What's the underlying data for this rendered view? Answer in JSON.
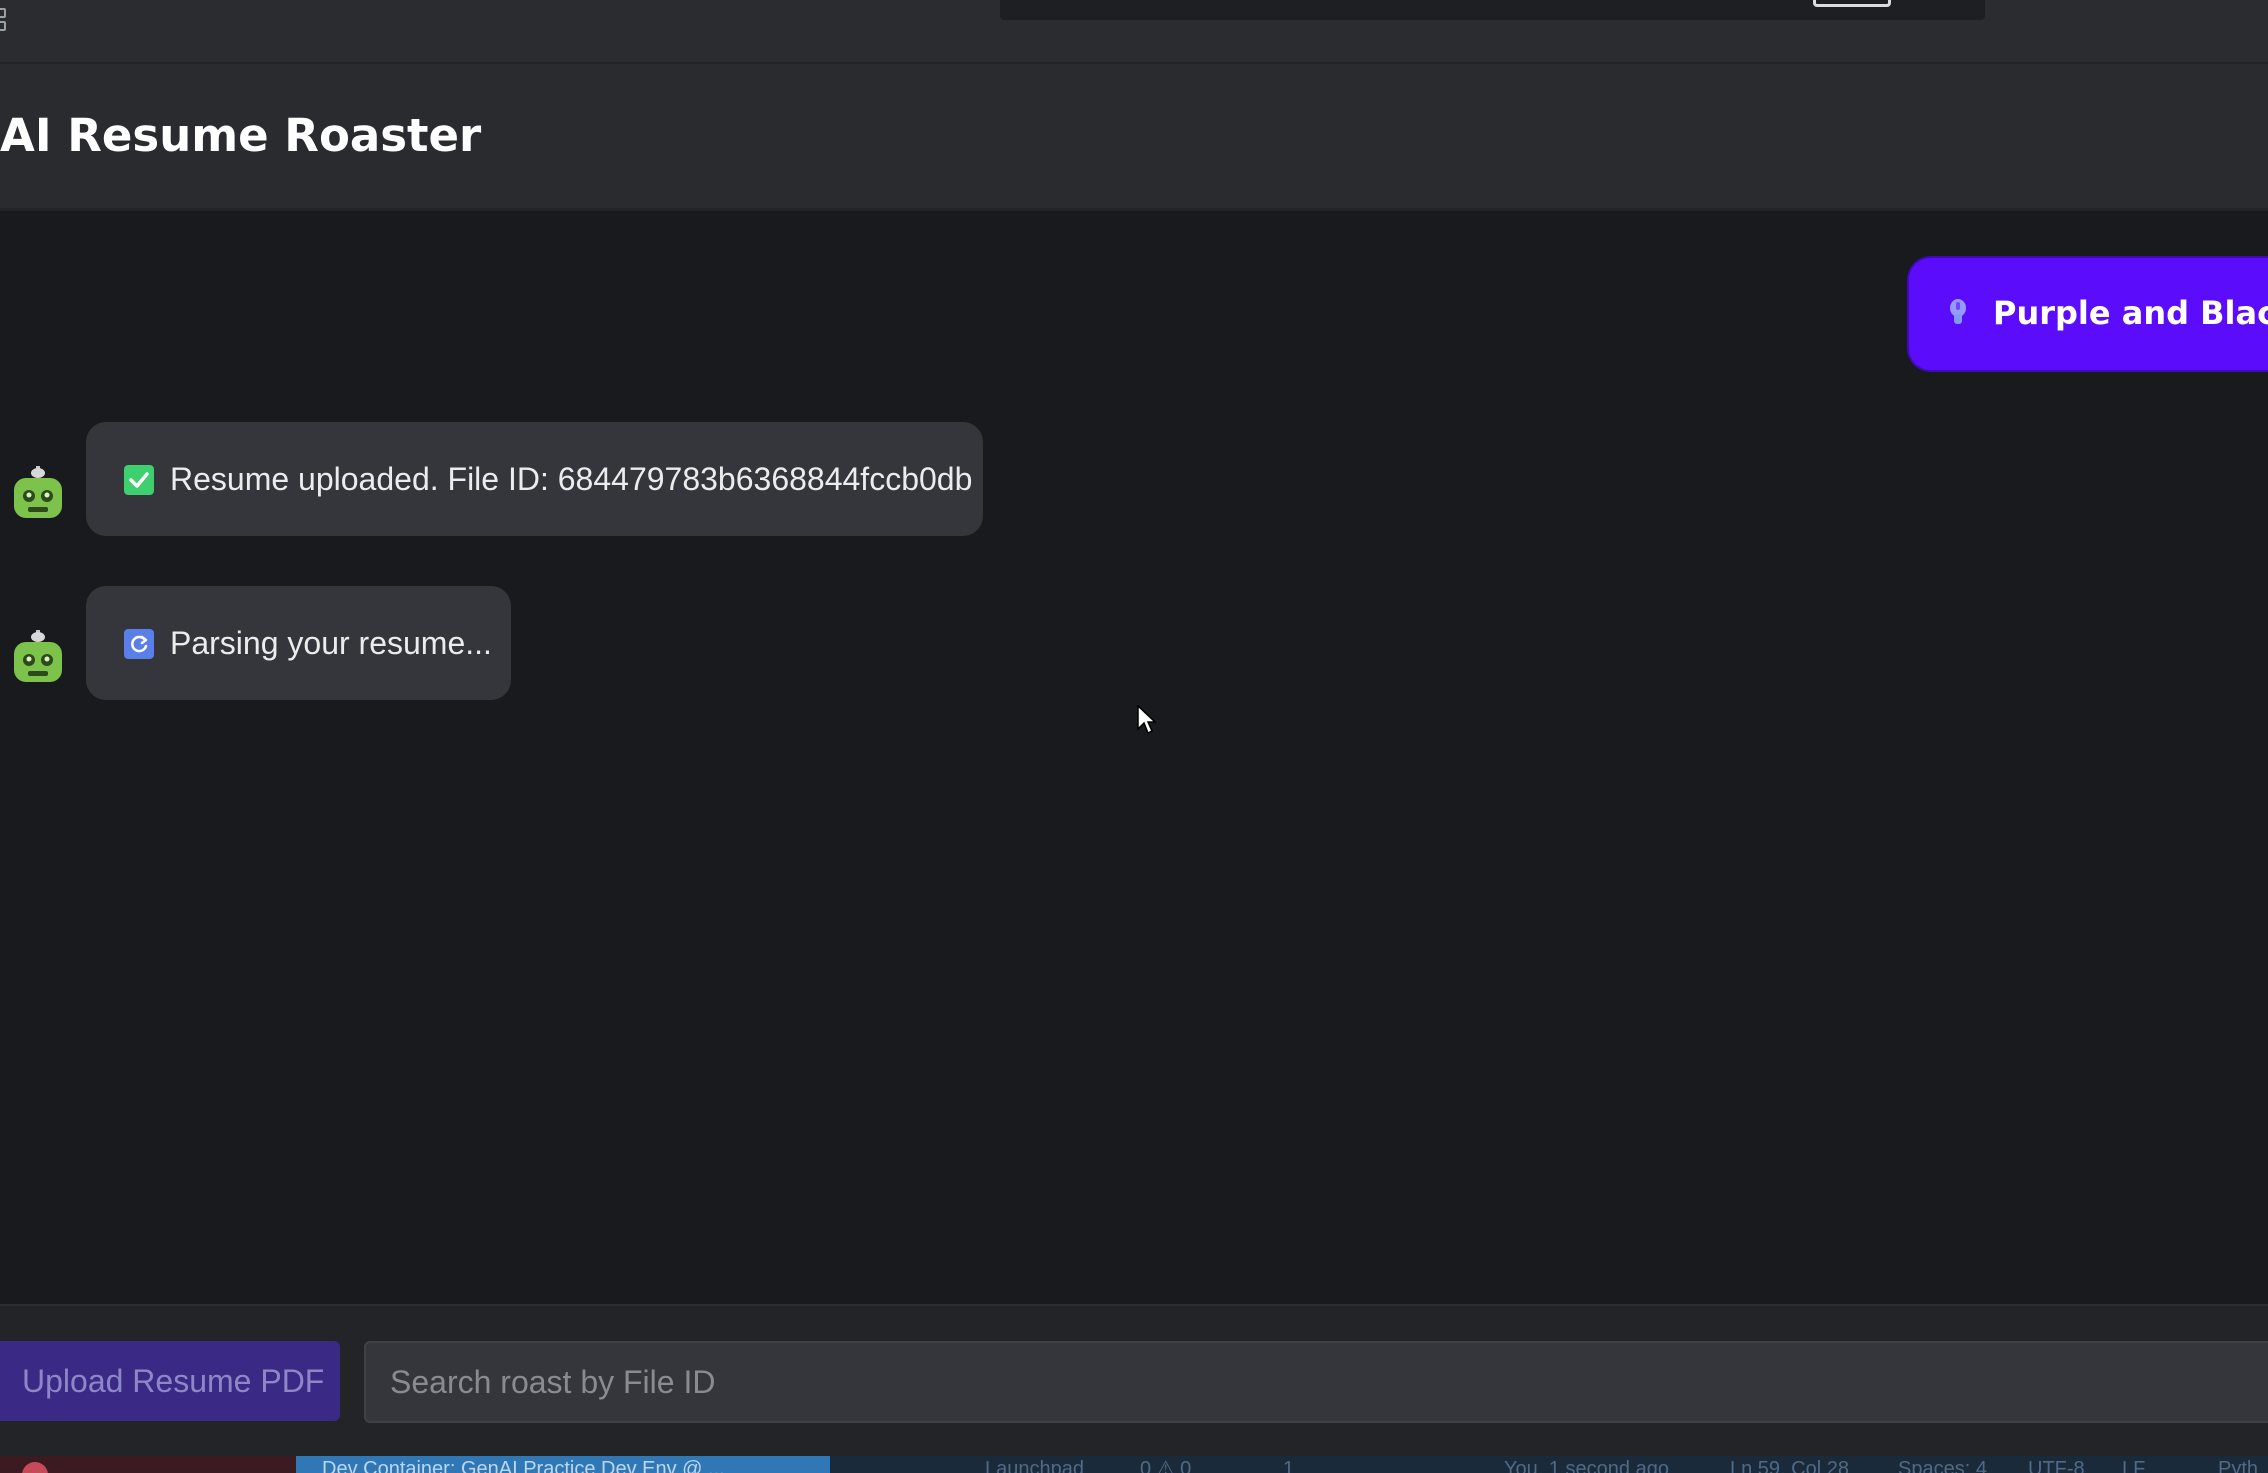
{
  "header": {
    "title": "AI Resume Roaster"
  },
  "chat": {
    "user_message": {
      "icon": "pin-icon",
      "text": "Purple and Black M"
    },
    "bot_messages": [
      {
        "icon": "check-box-icon",
        "icon_color": "#3ecf6e",
        "text": "Resume uploaded. File ID: 684479783b6368844fccb0db"
      },
      {
        "icon": "refresh-icon",
        "icon_color": "#5b7fe8",
        "text": "Parsing your resume..."
      }
    ],
    "avatar_icon": "robot-icon",
    "avatar_color": "#7dc24b"
  },
  "input_bar": {
    "upload_label": "Upload Resume PDF",
    "search_placeholder": "Search roast by File ID",
    "search_value": ""
  },
  "status_bar": {
    "container": "Dev Container: GenAI Practice Dev Env @ ...",
    "launchpad": "Launchpad",
    "problems": "0 ⚠ 0",
    "ports": "1",
    "blame": "You, 1 second ago",
    "position": "Ln 59, Col 28",
    "spaces": "Spaces: 4",
    "encoding": "UTF-8",
    "eol": "LF",
    "language": "Pyth"
  },
  "colors": {
    "accent": "#5b0dfb",
    "bubble": "#35363b",
    "background": "#181a1d"
  }
}
